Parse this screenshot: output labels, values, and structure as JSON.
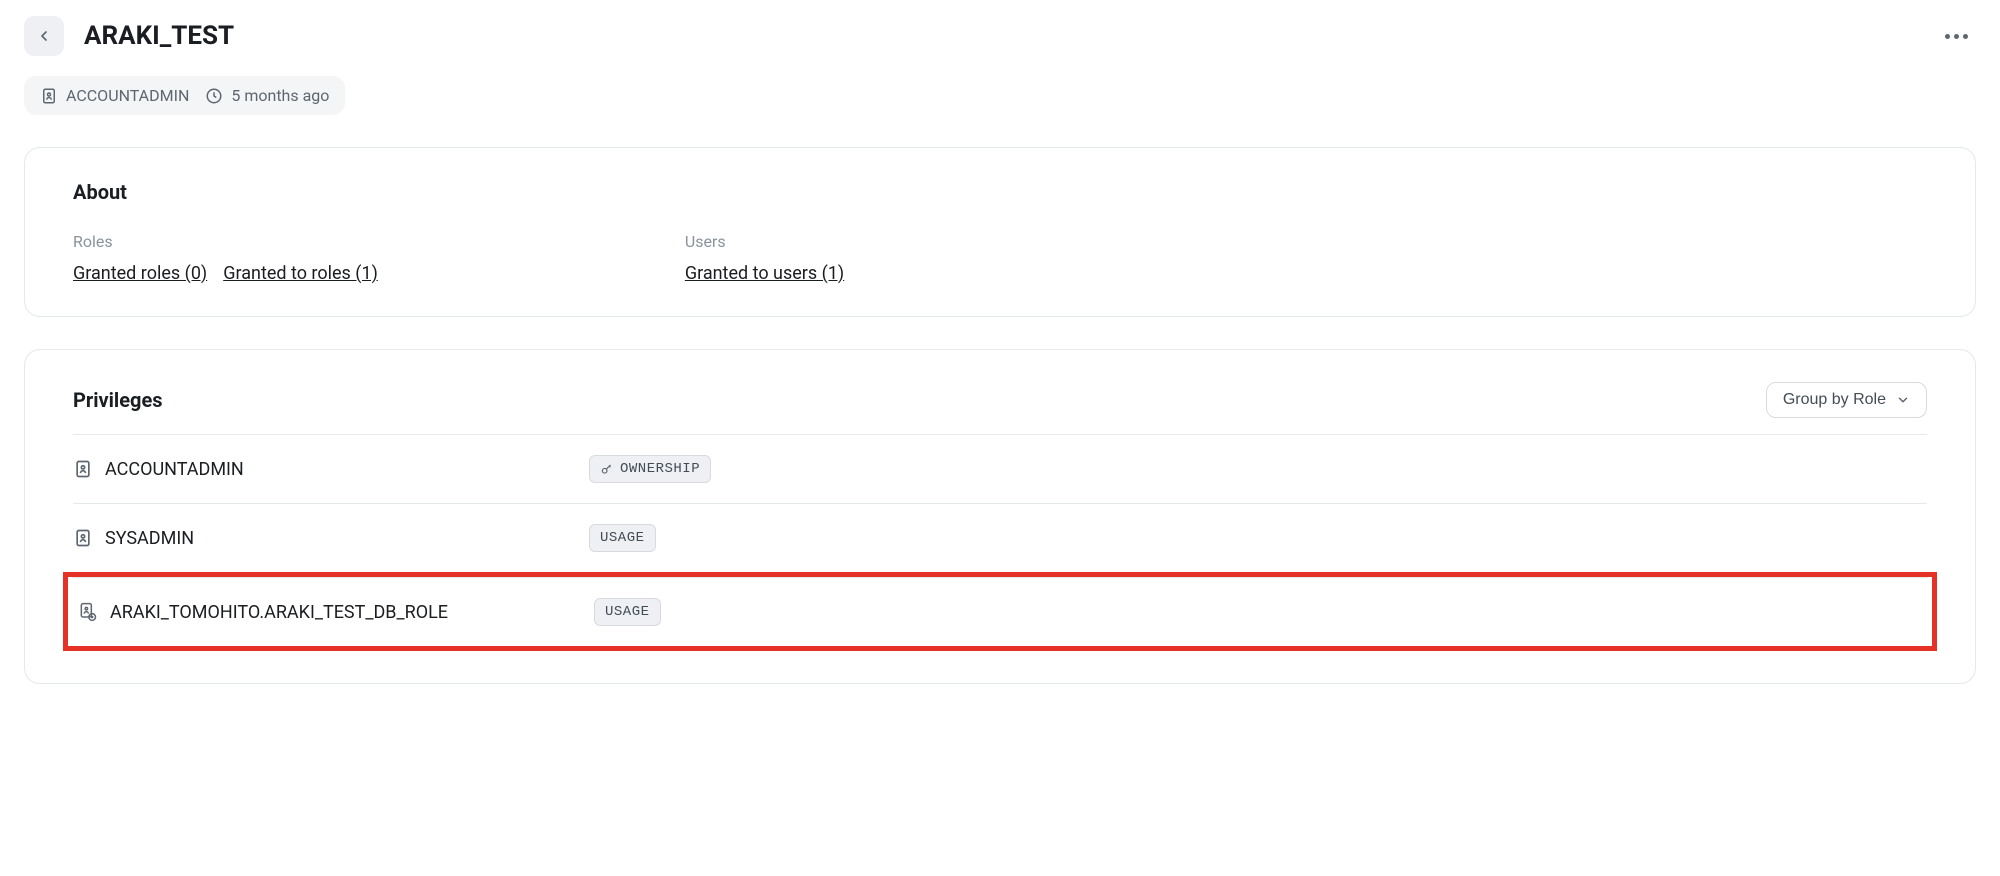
{
  "header": {
    "title": "ARAKI_TEST",
    "owner": "ACCOUNTADMIN",
    "age": "5 months ago"
  },
  "about": {
    "title": "About",
    "roles_label": "Roles",
    "users_label": "Users",
    "granted_roles": "Granted roles (0)",
    "granted_to_roles": "Granted to roles (1)",
    "granted_to_users": "Granted to users (1)"
  },
  "privileges": {
    "title": "Privileges",
    "group_by_label": "Group by Role",
    "rows": [
      {
        "name": "ACCOUNTADMIN",
        "badge": "OWNERSHIP",
        "has_key_icon": true,
        "icon": "role"
      },
      {
        "name": "SYSADMIN",
        "badge": "USAGE",
        "has_key_icon": false,
        "icon": "role"
      },
      {
        "name": "ARAKI_TOMOHITO.ARAKI_TEST_DB_ROLE",
        "badge": "USAGE",
        "has_key_icon": false,
        "icon": "db-role",
        "highlighted": true
      }
    ]
  }
}
